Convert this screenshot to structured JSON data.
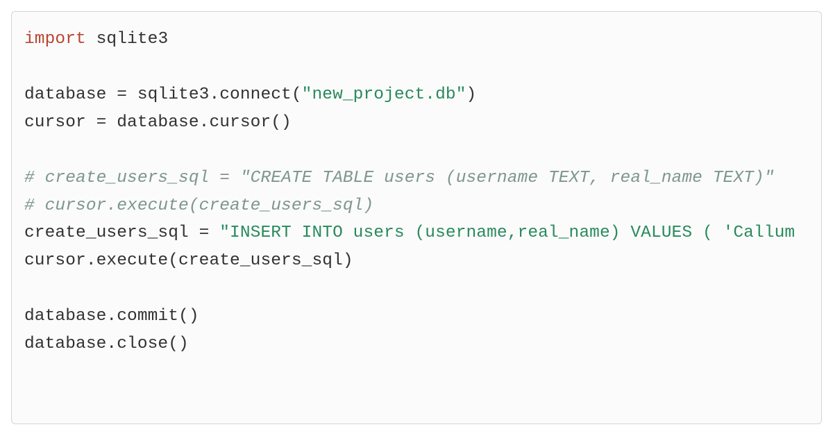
{
  "code": {
    "lines": [
      {
        "tokens": [
          {
            "cls": "tok-kw",
            "t": "import"
          },
          {
            "cls": "tok-txt",
            "t": " sqlite3"
          }
        ]
      },
      {
        "tokens": [
          {
            "cls": "tok-txt",
            "t": ""
          }
        ]
      },
      {
        "tokens": [
          {
            "cls": "tok-txt",
            "t": "database = sqlite3.connect("
          },
          {
            "cls": "tok-str",
            "t": "\"new_project.db\""
          },
          {
            "cls": "tok-txt",
            "t": ")"
          }
        ]
      },
      {
        "tokens": [
          {
            "cls": "tok-txt",
            "t": "cursor = database.cursor()"
          }
        ]
      },
      {
        "tokens": [
          {
            "cls": "tok-txt",
            "t": ""
          }
        ]
      },
      {
        "tokens": [
          {
            "cls": "tok-cmt",
            "t": "# create_users_sql = \"CREATE TABLE users (username TEXT, real_name TEXT)\""
          }
        ]
      },
      {
        "tokens": [
          {
            "cls": "tok-cmt",
            "t": "# cursor.execute(create_users_sql)"
          }
        ]
      },
      {
        "tokens": [
          {
            "cls": "tok-txt",
            "t": "create_users_sql = "
          },
          {
            "cls": "tok-str",
            "t": "\"INSERT INTO users (username,real_name) VALUES ( 'Callum"
          }
        ]
      },
      {
        "tokens": [
          {
            "cls": "tok-txt",
            "t": "cursor.execute(create_users_sql)"
          }
        ]
      },
      {
        "tokens": [
          {
            "cls": "tok-txt",
            "t": ""
          }
        ]
      },
      {
        "tokens": [
          {
            "cls": "tok-txt",
            "t": "database.commit()"
          }
        ]
      },
      {
        "tokens": [
          {
            "cls": "tok-txt",
            "t": "database.close()"
          }
        ]
      }
    ]
  }
}
